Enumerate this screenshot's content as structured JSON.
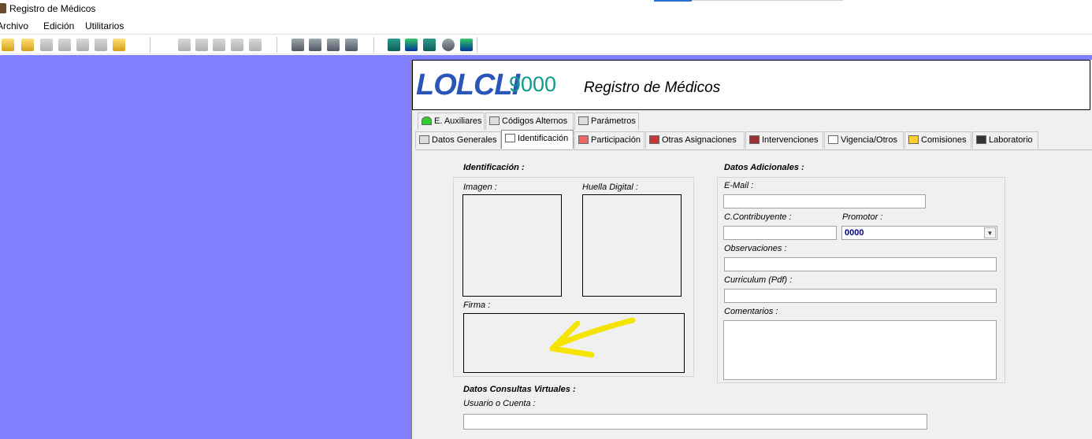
{
  "window": {
    "title": "Registro de Médicos"
  },
  "menu": [
    "Archivo",
    "Edición",
    "Utilitarios"
  ],
  "toolbar_icons": [
    "exit-icon",
    "new-icon",
    "save-icon",
    "database-icon",
    "print-icon",
    "preview-icon",
    "door-icon",
    "undo-icon",
    "cut-icon",
    "copy-icon",
    "paste-icon",
    "eraser-icon",
    "find-icon",
    "copy-record-icon",
    "check-icon",
    "edit-icon",
    "calculator-icon",
    "calendar-icon",
    "book-icon",
    "info-icon",
    "help-icon"
  ],
  "banner": {
    "logo": "LOLCLI",
    "logo_number": "9000",
    "title": "Registro de Médicos"
  },
  "tabs_row1": [
    {
      "label": "E. Auxiliares",
      "icon": "triangle-icon"
    },
    {
      "label": "Códigos Alternos",
      "icon": "window-icon"
    },
    {
      "label": "Parámetros",
      "icon": "monitor-icon"
    }
  ],
  "tabs_row2": [
    {
      "label": "Datos Generales",
      "icon": "card-icon"
    },
    {
      "label": "Identificación",
      "icon": "id-icon",
      "active": true
    },
    {
      "label": "Participación",
      "icon": "flow-icon"
    },
    {
      "label": "Otras Asignaciones",
      "icon": "blocks-icon"
    },
    {
      "label": "Intervenciones",
      "icon": "scalpel-icon"
    },
    {
      "label": "Vigencia/Otros",
      "icon": "calendar-icon"
    },
    {
      "label": "Comisiones",
      "icon": "money-icon"
    },
    {
      "label": "Laboratorio",
      "icon": "flask-icon"
    }
  ],
  "identificacion": {
    "section_title": "Identificación :",
    "imagen_label": "Imagen :",
    "huella_label": "Huella Digital :",
    "firma_label": "Firma :"
  },
  "datos_adicionales": {
    "section_title": "Datos Adicionales :",
    "email_label": "E-Mail :",
    "email_value": "",
    "contribuyente_label": "C.Contribuyente :",
    "contribuyente_value": "",
    "promotor_label": "Promotor :",
    "promotor_value": "0000",
    "observaciones_label": "Observaciones :",
    "observaciones_value": "",
    "curriculum_label": "Curriculum (Pdf) :",
    "curriculum_value": "",
    "comentarios_label": "Comentarios :",
    "comentarios_value": ""
  },
  "consultas_virtuales": {
    "section_title": "Datos Consultas Virtuales :",
    "usuario_label": "Usuario o Cuenta :",
    "usuario_value": ""
  },
  "colors": {
    "workspace": "#8080ff",
    "arrow": "#f4e400",
    "logo": "#2a56b8",
    "logo_number": "#0f9a8e"
  }
}
